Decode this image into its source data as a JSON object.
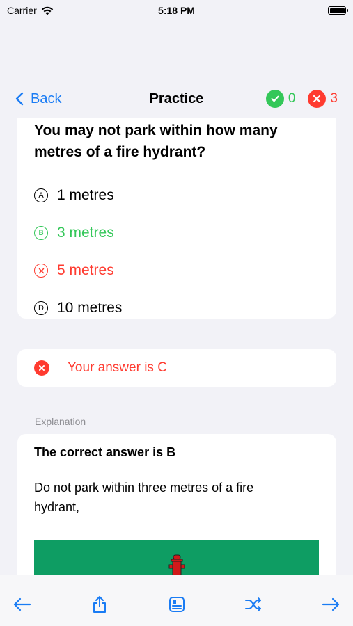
{
  "status_bar": {
    "carrier": "Carrier",
    "time": "5:18 PM"
  },
  "nav": {
    "back_label": "Back",
    "title": "Practice",
    "correct_count": "0",
    "wrong_count": "3"
  },
  "question": {
    "text": "You may not park within how many metres of a fire hydrant?",
    "options": [
      {
        "letter": "A",
        "label": "1 metres",
        "state": "neutral"
      },
      {
        "letter": "B",
        "label": "3 metres",
        "state": "correct"
      },
      {
        "letter": "C",
        "label": "5 metres",
        "state": "wrong"
      },
      {
        "letter": "D",
        "label": "10 metres",
        "state": "neutral"
      }
    ]
  },
  "answer_feedback": {
    "text": "Your answer is C"
  },
  "explanation": {
    "section_label": "Explanation",
    "title": "The correct answer is B",
    "body": "Do not park within three metres of a fire hydrant,"
  },
  "toolbar": {
    "icons": [
      "arrow-left-icon",
      "share-icon",
      "card-icon",
      "shuffle-icon",
      "arrow-right-icon"
    ]
  },
  "colors": {
    "accent": "#1a7cf4",
    "correct": "#34c759",
    "wrong": "#ff3b30",
    "image_bg": "#0e9d63"
  }
}
